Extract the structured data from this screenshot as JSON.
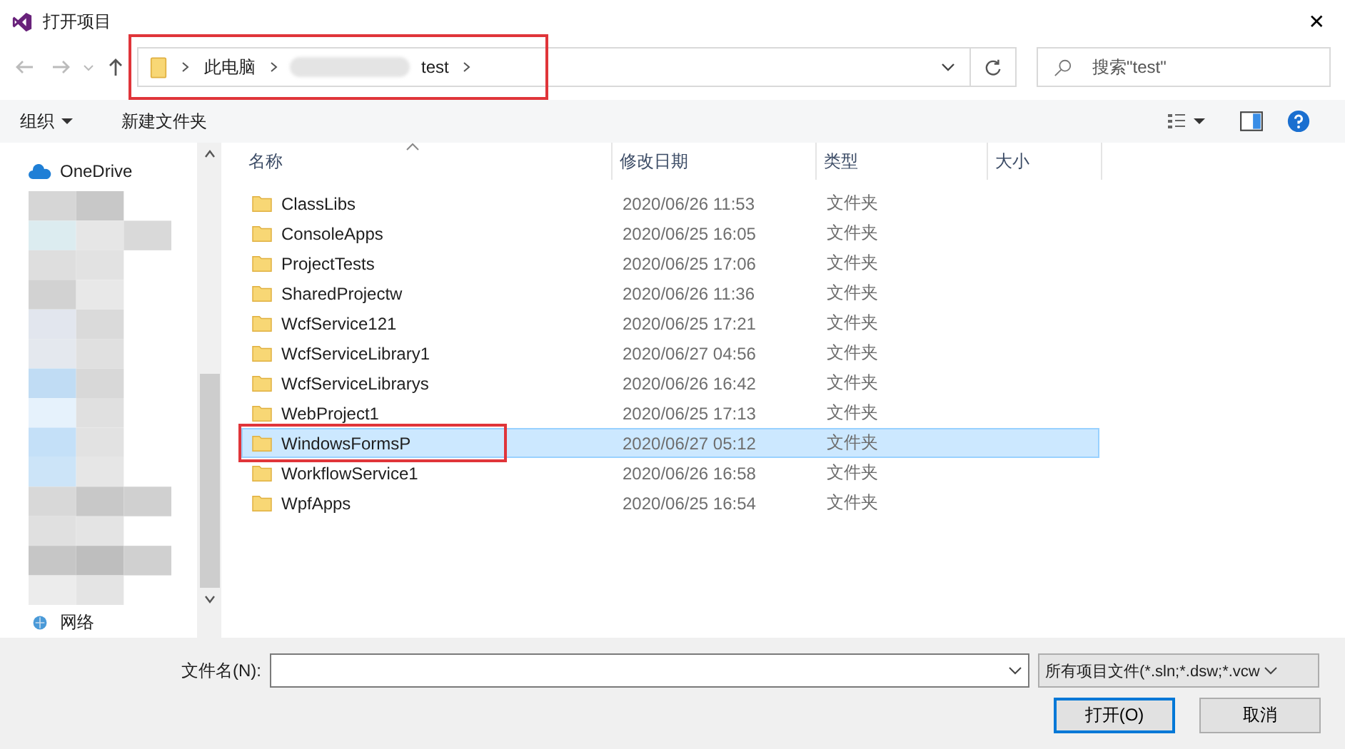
{
  "window": {
    "title": "打开项目",
    "close": "✕"
  },
  "address_bar": {
    "highlighted": true,
    "segments": [
      "此电脑",
      "test"
    ]
  },
  "search": {
    "placeholder": "搜索\"test\""
  },
  "toolbar": {
    "organize": "组织",
    "new_folder": "新建文件夹"
  },
  "sidebar": {
    "items": [
      {
        "label": "OneDrive",
        "kind": "cloud"
      },
      {
        "label": "网络",
        "kind": "network"
      }
    ]
  },
  "table": {
    "columns": [
      "名称",
      "修改日期",
      "类型",
      "大小"
    ],
    "rows": [
      {
        "name": "ClassLibs",
        "modified": "2020/06/26 11:53",
        "type": "文件夹",
        "selected": false,
        "highlighted": false
      },
      {
        "name": "ConsoleApps",
        "modified": "2020/06/25 16:05",
        "type": "文件夹",
        "selected": false,
        "highlighted": false
      },
      {
        "name": "ProjectTests",
        "modified": "2020/06/25 17:06",
        "type": "文件夹",
        "selected": false,
        "highlighted": false
      },
      {
        "name": "SharedProjectw",
        "modified": "2020/06/26 11:36",
        "type": "文件夹",
        "selected": false,
        "highlighted": false
      },
      {
        "name": "WcfService121",
        "modified": "2020/06/25 17:21",
        "type": "文件夹",
        "selected": false,
        "highlighted": false
      },
      {
        "name": "WcfServiceLibrary1",
        "modified": "2020/06/27 04:56",
        "type": "文件夹",
        "selected": false,
        "highlighted": false
      },
      {
        "name": "WcfServiceLibrarys",
        "modified": "2020/06/26 16:42",
        "type": "文件夹",
        "selected": false,
        "highlighted": false
      },
      {
        "name": "WebProject1",
        "modified": "2020/06/25 17:13",
        "type": "文件夹",
        "selected": false,
        "highlighted": false
      },
      {
        "name": "WindowsFormsP",
        "modified": "2020/06/27 05:12",
        "type": "文件夹",
        "selected": true,
        "highlighted": true
      },
      {
        "name": "WorkflowService1",
        "modified": "2020/06/26 16:58",
        "type": "文件夹",
        "selected": false,
        "highlighted": false
      },
      {
        "name": "WpfApps",
        "modified": "2020/06/25 16:54",
        "type": "文件夹",
        "selected": false,
        "highlighted": false
      }
    ]
  },
  "footer": {
    "filename_label": "文件名(N):",
    "filetype": "所有项目文件(*.sln;*.dsw;*.vcw",
    "open": "打开(O)",
    "cancel": "取消"
  }
}
